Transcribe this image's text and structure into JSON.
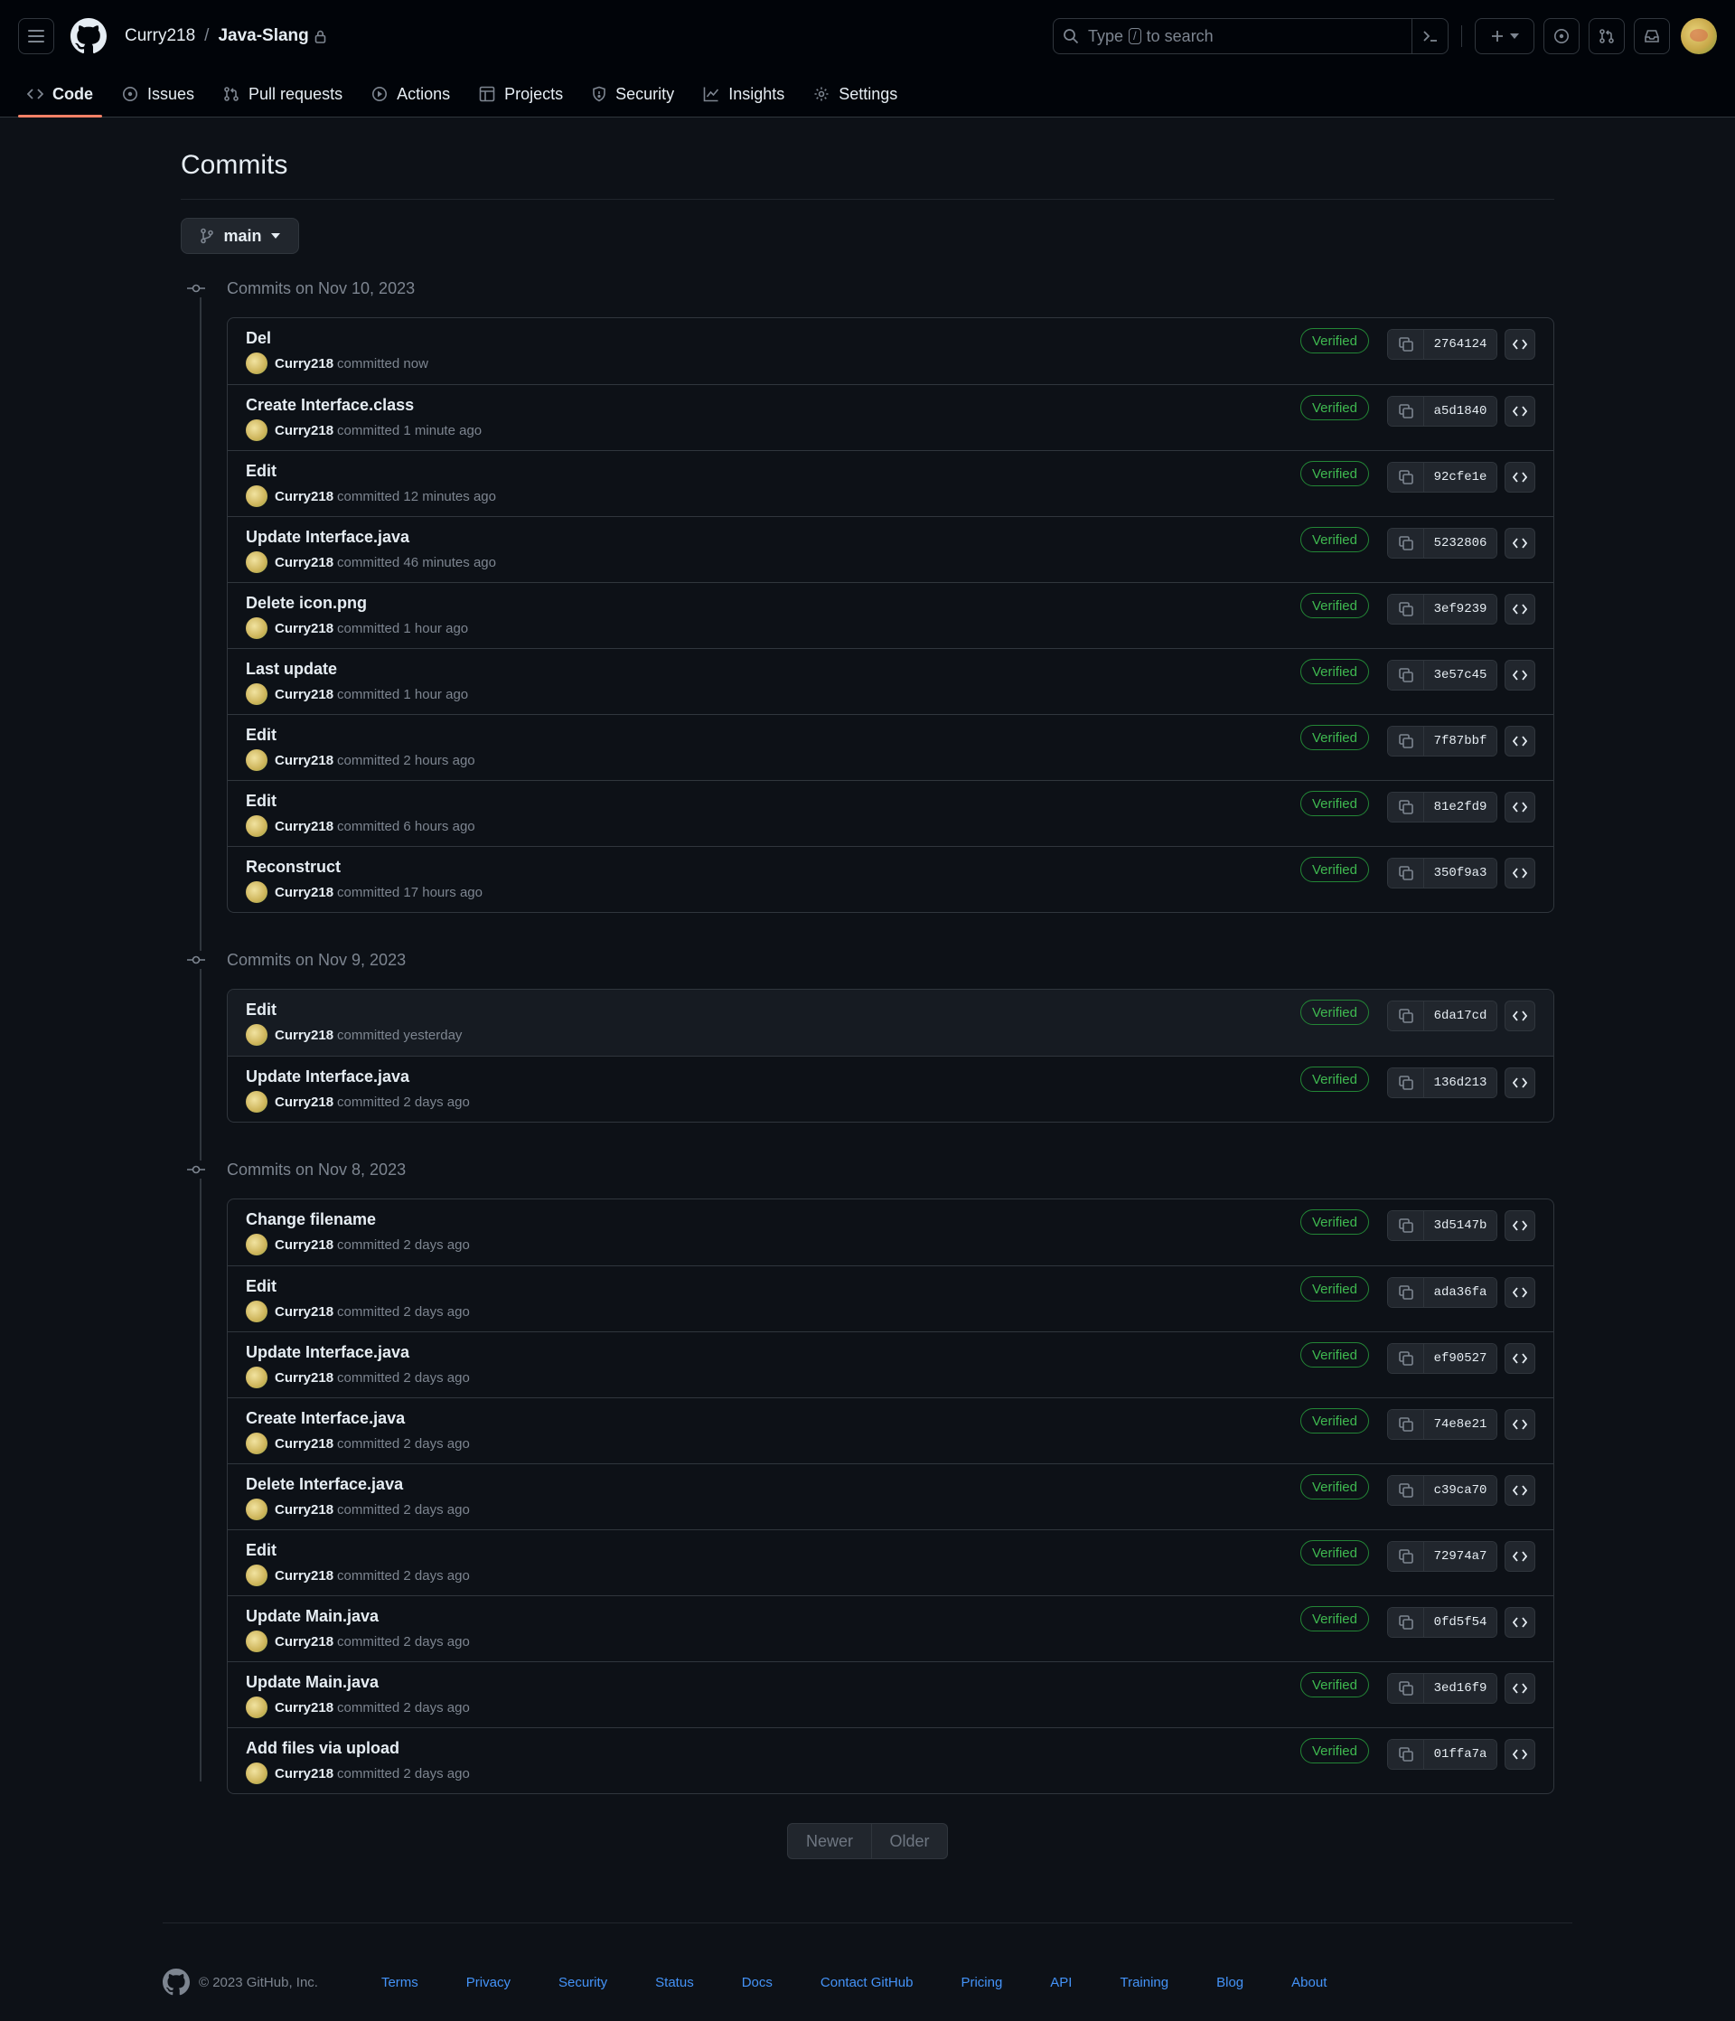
{
  "header": {
    "owner": "Curry218",
    "separator": "/",
    "repo": "Java-Slang",
    "search_prefix": "Type",
    "search_key": "/",
    "search_suffix": "to search",
    "tabs": [
      {
        "label": "Code",
        "icon": "code-icon",
        "active": true
      },
      {
        "label": "Issues",
        "icon": "issue-icon"
      },
      {
        "label": "Pull requests",
        "icon": "pull-request-icon"
      },
      {
        "label": "Actions",
        "icon": "play-icon"
      },
      {
        "label": "Projects",
        "icon": "table-icon"
      },
      {
        "label": "Security",
        "icon": "shield-icon"
      },
      {
        "label": "Insights",
        "icon": "graph-icon"
      },
      {
        "label": "Settings",
        "icon": "gear-icon"
      }
    ]
  },
  "page": {
    "title": "Commits",
    "branch": "main"
  },
  "groups": [
    {
      "heading": "Commits on Nov 10, 2023",
      "commits": [
        {
          "message": "Del",
          "author": "Curry218",
          "when": "committed now",
          "verified": "Verified",
          "sha": "2764124"
        },
        {
          "message": "Create Interface.class",
          "author": "Curry218",
          "when": "committed 1 minute ago",
          "verified": "Verified",
          "sha": "a5d1840"
        },
        {
          "message": "Edit",
          "author": "Curry218",
          "when": "committed 12 minutes ago",
          "verified": "Verified",
          "sha": "92cfe1e"
        },
        {
          "message": "Update Interface.java",
          "author": "Curry218",
          "when": "committed 46 minutes ago",
          "verified": "Verified",
          "sha": "5232806"
        },
        {
          "message": "Delete icon.png",
          "author": "Curry218",
          "when": "committed 1 hour ago",
          "verified": "Verified",
          "sha": "3ef9239"
        },
        {
          "message": "Last update",
          "author": "Curry218",
          "when": "committed 1 hour ago",
          "verified": "Verified",
          "sha": "3e57c45"
        },
        {
          "message": "Edit",
          "author": "Curry218",
          "when": "committed 2 hours ago",
          "verified": "Verified",
          "sha": "7f87bbf"
        },
        {
          "message": "Edit",
          "author": "Curry218",
          "when": "committed 6 hours ago",
          "verified": "Verified",
          "sha": "81e2fd9"
        },
        {
          "message": "Reconstruct",
          "author": "Curry218",
          "when": "committed 17 hours ago",
          "verified": "Verified",
          "sha": "350f9a3"
        }
      ]
    },
    {
      "heading": "Commits on Nov 9, 2023",
      "commits": [
        {
          "message": "Edit",
          "author": "Curry218",
          "when": "committed yesterday",
          "verified": "Verified",
          "sha": "6da17cd",
          "highlighted": true
        },
        {
          "message": "Update Interface.java",
          "author": "Curry218",
          "when": "committed 2 days ago",
          "verified": "Verified",
          "sha": "136d213"
        }
      ]
    },
    {
      "heading": "Commits on Nov 8, 2023",
      "commits": [
        {
          "message": "Change filename",
          "author": "Curry218",
          "when": "committed 2 days ago",
          "verified": "Verified",
          "sha": "3d5147b"
        },
        {
          "message": "Edit",
          "author": "Curry218",
          "when": "committed 2 days ago",
          "verified": "Verified",
          "sha": "ada36fa"
        },
        {
          "message": "Update Interface.java",
          "author": "Curry218",
          "when": "committed 2 days ago",
          "verified": "Verified",
          "sha": "ef90527"
        },
        {
          "message": "Create Interface.java",
          "author": "Curry218",
          "when": "committed 2 days ago",
          "verified": "Verified",
          "sha": "74e8e21"
        },
        {
          "message": "Delete Interface.java",
          "author": "Curry218",
          "when": "committed 2 days ago",
          "verified": "Verified",
          "sha": "c39ca70"
        },
        {
          "message": "Edit",
          "author": "Curry218",
          "when": "committed 2 days ago",
          "verified": "Verified",
          "sha": "72974a7"
        },
        {
          "message": "Update Main.java",
          "author": "Curry218",
          "when": "committed 2 days ago",
          "verified": "Verified",
          "sha": "0fd5f54"
        },
        {
          "message": "Update Main.java",
          "author": "Curry218",
          "when": "committed 2 days ago",
          "verified": "Verified",
          "sha": "3ed16f9"
        },
        {
          "message": "Add files via upload",
          "author": "Curry218",
          "when": "committed 2 days ago",
          "verified": "Verified",
          "sha": "01ffa7a"
        }
      ]
    }
  ],
  "pagination": {
    "newer": "Newer",
    "older": "Older"
  },
  "footer": {
    "copyright": "© 2023 GitHub, Inc.",
    "links": [
      "Terms",
      "Privacy",
      "Security",
      "Status",
      "Docs",
      "Contact GitHub",
      "Pricing",
      "API",
      "Training",
      "Blog",
      "About"
    ]
  },
  "colors": {
    "background": "#0d1117",
    "header_bg": "#010409",
    "border": "#30363d",
    "verified_green": "#3fb950",
    "tab_underline": "#f78166",
    "link_blue": "#4493f8"
  }
}
